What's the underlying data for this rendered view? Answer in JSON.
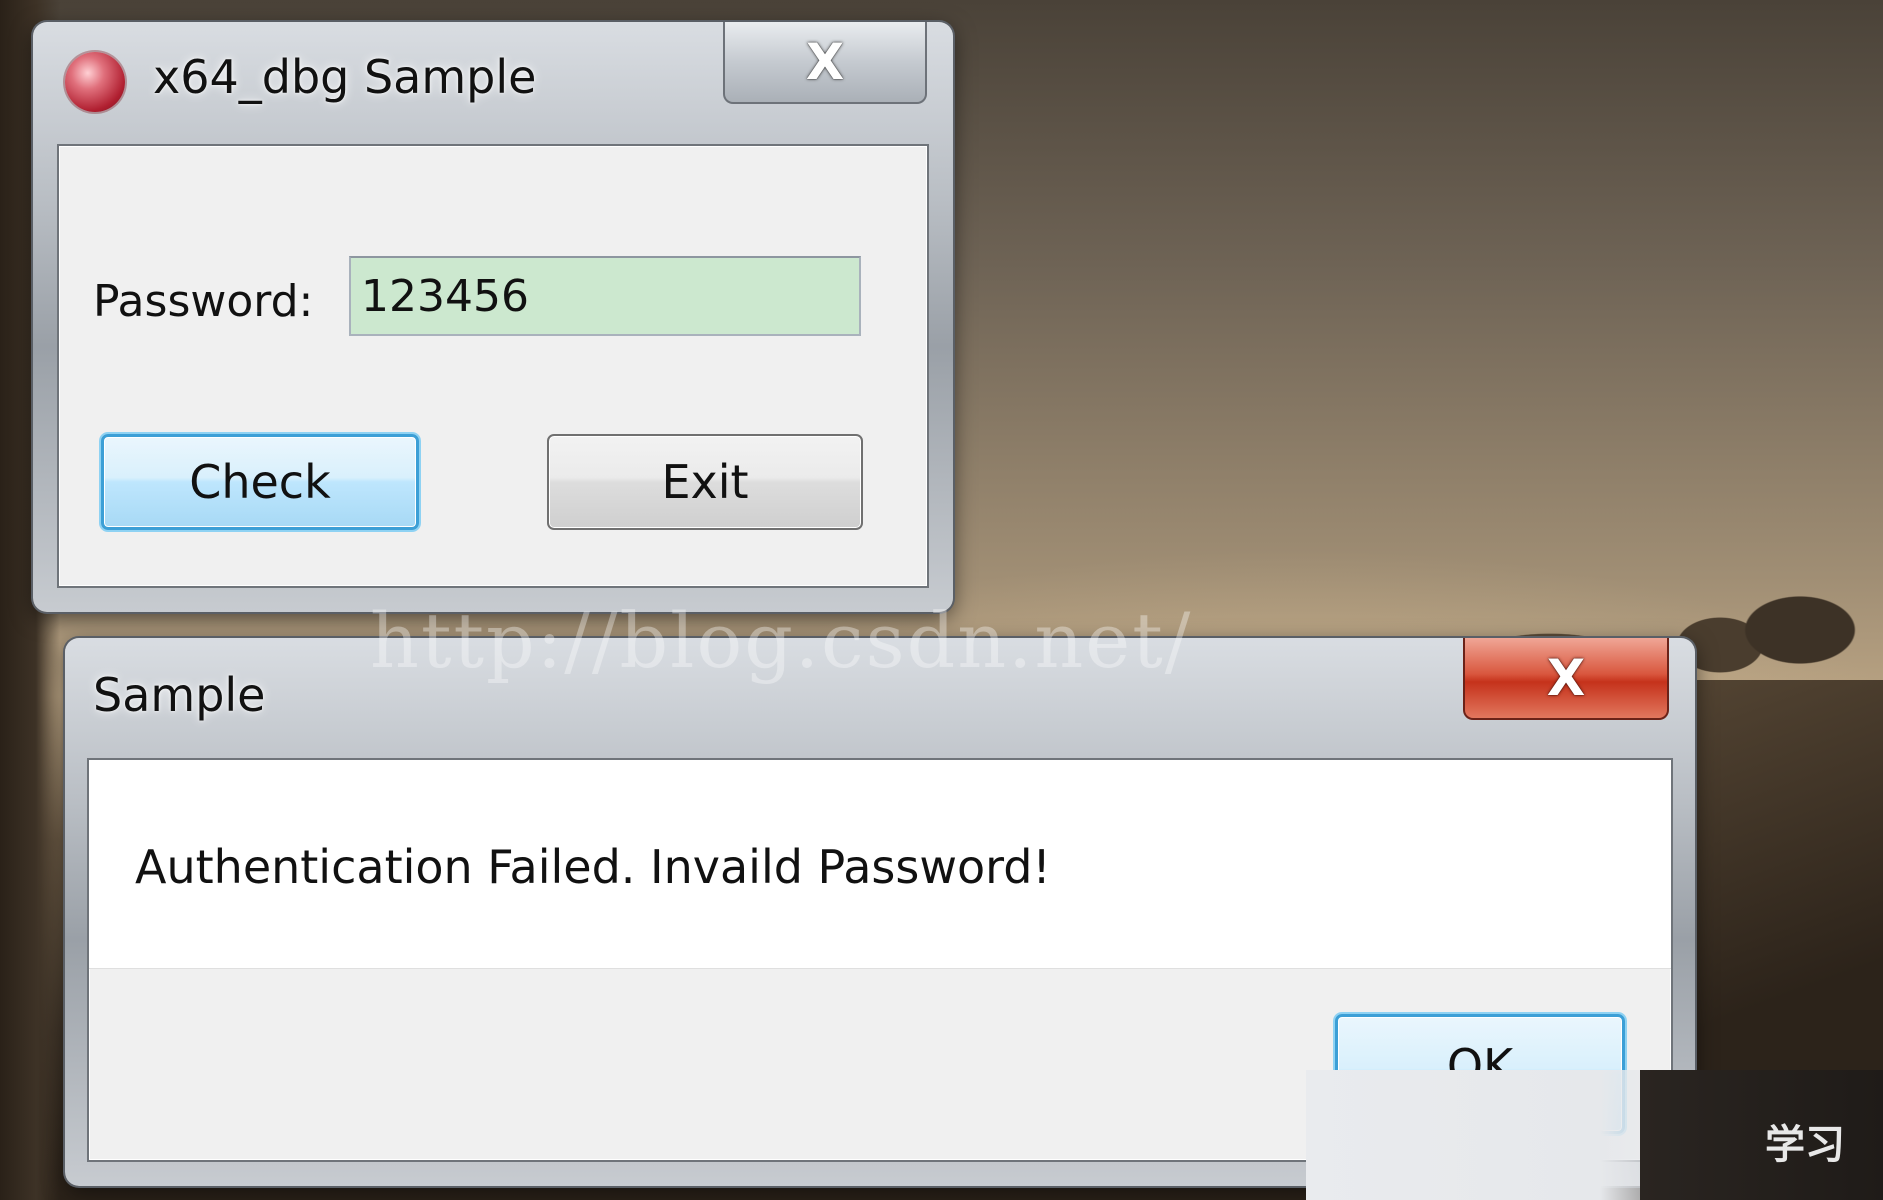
{
  "main_window": {
    "title": "x64_dbg Sample",
    "close_glyph": "X",
    "icon": "app-icon",
    "password_label": "Password:",
    "password_value": "123456",
    "check_button": "Check",
    "exit_button": "Exit"
  },
  "message_box": {
    "title": "Sample",
    "close_glyph": "X",
    "message": "Authentication Failed. Invaild Password!",
    "ok_button": "OK"
  },
  "overlay": {
    "watermark": "http://blog.csdn.net/",
    "corner_text": "学习"
  },
  "colors": {
    "password_field_bg": "#cce8cf",
    "focused_button_border": "#3c9fd6",
    "message_close_red": "#c5321b"
  }
}
